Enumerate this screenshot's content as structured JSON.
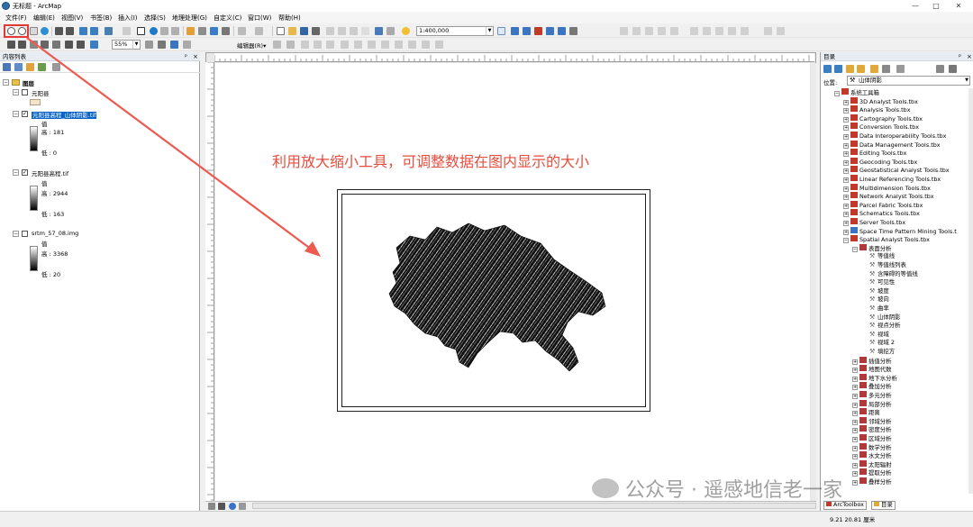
{
  "window": {
    "title": "无标题 - ArcMap",
    "controls": [
      "—",
      "□",
      "✕"
    ]
  },
  "menu": [
    "文件(F)",
    "编辑(E)",
    "视图(V)",
    "书签(B)",
    "插入(I)",
    "选择(S)",
    "地理处理(G)",
    "自定义(C)",
    "窗口(W)",
    "帮助(H)"
  ],
  "toolbar": {
    "scale_value": "1:400,000",
    "zoom_percent": "55%",
    "editor_label": "编辑器(R)▾"
  },
  "toc": {
    "title": "内容列表",
    "root_label": "图层",
    "layers": [
      {
        "name": "元阳县",
        "checked": false
      },
      {
        "name": "元阳县高程_山体阴影.tif",
        "checked": true,
        "value_label": "值",
        "high": "高 : 181",
        "low": "低 : 0"
      },
      {
        "name": "元阳县高程.tif",
        "checked": true,
        "value_label": "值",
        "high": "高 : 2944",
        "low": "低 : 163"
      },
      {
        "name": "srtm_57_08.img",
        "checked": false,
        "value_label": "值",
        "high": "高 : 3368",
        "low": "低 : 20"
      }
    ]
  },
  "annotation": "利用放大缩小工具，可调整数据在图内显示的大小",
  "catalog": {
    "title": "目录",
    "location_label": "位置:",
    "location_value": "山体阴影",
    "root": "系统工具箱",
    "toolboxes": [
      "3D Analyst Tools.tbx",
      "Analysis Tools.tbx",
      "Cartography Tools.tbx",
      "Conversion Tools.tbx",
      "Data Interoperability Tools.tbx",
      "Data Management Tools.tbx",
      "Editing Tools.tbx",
      "Geocoding Tools.tbx",
      "Geostatistical Analyst Tools.tbx",
      "Linear Referencing Tools.tbx",
      "Multidimension Tools.tbx",
      "Network Analyst Tools.tbx",
      "Parcel Fabric Tools.tbx",
      "Schematics Tools.tbx",
      "Server Tools.tbx",
      "Space Time Pattern Mining Tools.t",
      "Spatial Analyst Tools.tbx"
    ],
    "surface_group": "表面分析",
    "surface_tools": [
      "等值线",
      "等值线列表",
      "含障碍的等值线",
      "可见性",
      "坡度",
      "坡向",
      "曲率",
      "山体阴影",
      "视点分析",
      "视域",
      "视域 2",
      "填挖方"
    ],
    "other_groups": [
      "插值分析",
      "地图代数",
      "地下水分析",
      "叠加分析",
      "多元分析",
      "局部分析",
      "距离",
      "邻域分析",
      "密度分析",
      "区域分析",
      "数学分析",
      "水文分析",
      "太阳辐射",
      "提取分析",
      "叠样分析"
    ],
    "tabs": [
      "ArcToolbox",
      "目录"
    ]
  },
  "status": {
    "coords": "9.21  20.81 厘米"
  },
  "watermark": "公众号 · 遥感地信老一家"
}
